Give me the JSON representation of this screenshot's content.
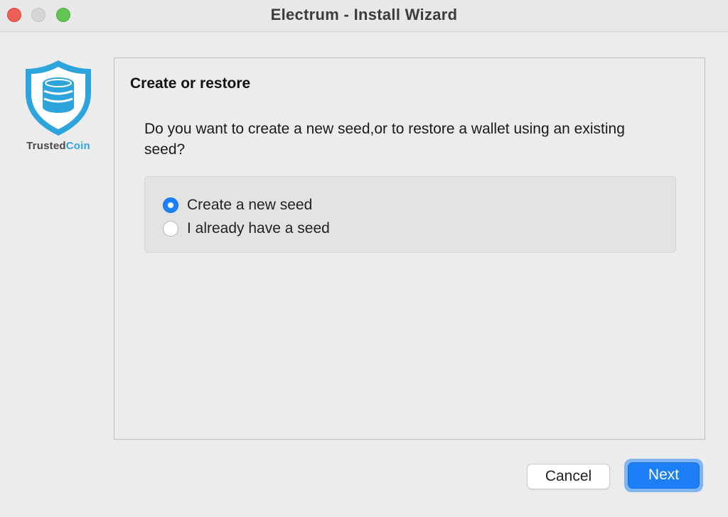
{
  "window": {
    "title": "Electrum  -  Install Wizard"
  },
  "logo": {
    "brand_part1": "Trusted",
    "brand_part2": "Coin",
    "accent_color": "#2ea4dc"
  },
  "panel": {
    "title": "Create or restore",
    "question": "Do you want to create a new seed,or to restore a wallet using an existing seed?",
    "options": [
      {
        "label": "Create a new seed",
        "selected": true
      },
      {
        "label": "I already have a seed",
        "selected": false
      }
    ]
  },
  "buttons": {
    "cancel_label": "Cancel",
    "next_label": "Next"
  },
  "colors": {
    "primary_blue": "#1d7ff6",
    "window_bg": "#ececec"
  }
}
